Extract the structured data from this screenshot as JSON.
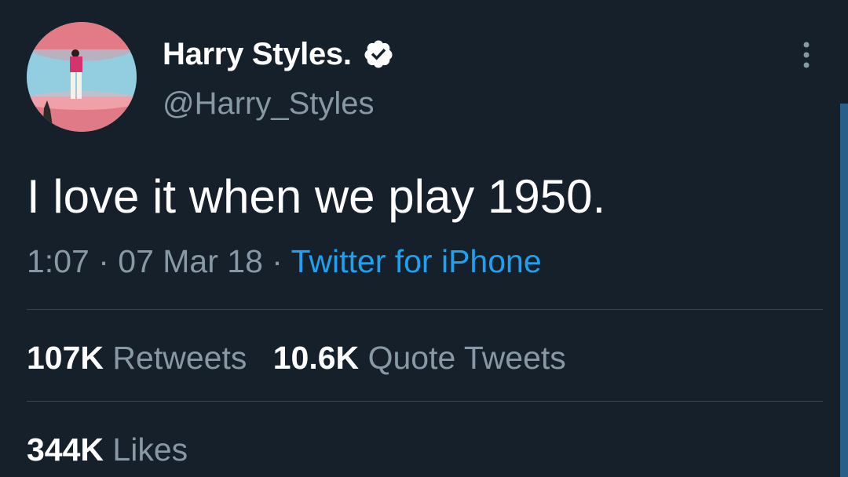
{
  "author": {
    "display_name": "Harry Styles.",
    "handle": "@Harry_Styles",
    "verified_icon": "verified-badge-icon",
    "avatar_icon": "profile-photo"
  },
  "tweet": {
    "text": "I love it when we play 1950.",
    "time": "1:07",
    "separator1": "·",
    "date": "07 Mar 18",
    "separator2": "·",
    "source": "Twitter for iPhone"
  },
  "stats": {
    "retweets_count": "107K",
    "retweets_label": "Retweets",
    "quotes_count": "10.6K",
    "quotes_label": "Quote Tweets",
    "likes_count": "344K",
    "likes_label": "Likes"
  },
  "menu": {
    "icon": "more-vertical-icon"
  },
  "colors": {
    "background": "#15202b",
    "text_primary": "#ffffff",
    "text_secondary": "#8899a6",
    "link": "#1da1f2",
    "divider": "#38444d"
  }
}
